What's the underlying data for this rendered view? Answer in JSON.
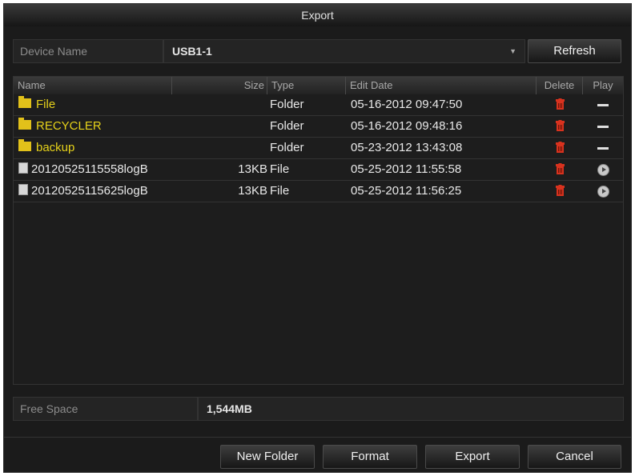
{
  "window": {
    "title": "Export"
  },
  "device": {
    "label": "Device Name",
    "value": "USB1-1",
    "refresh_label": "Refresh"
  },
  "table": {
    "columns": {
      "name": "Name",
      "size": "Size",
      "type": "Type",
      "edit_date": "Edit Date",
      "delete": "Delete",
      "play": "Play"
    },
    "rows": [
      {
        "name": "File",
        "size": "",
        "type": "Folder",
        "edit_date": "05-16-2012 09:47:50",
        "kind": "folder",
        "play": "none"
      },
      {
        "name": "RECYCLER",
        "size": "",
        "type": "Folder",
        "edit_date": "05-16-2012 09:48:16",
        "kind": "folder",
        "play": "none"
      },
      {
        "name": "backup",
        "size": "",
        "type": "Folder",
        "edit_date": "05-23-2012 13:43:08",
        "kind": "folder",
        "play": "none"
      },
      {
        "name": "20120525115558logB",
        "size": "13KB",
        "type": "File",
        "edit_date": "05-25-2012 11:55:58",
        "kind": "file",
        "play": "play-icon"
      },
      {
        "name": "20120525115625logB",
        "size": "13KB",
        "type": "File",
        "edit_date": "05-25-2012 11:56:25",
        "kind": "file",
        "play": "play-icon"
      }
    ]
  },
  "free_space": {
    "label": "Free Space",
    "value": "1,544MB"
  },
  "buttons": {
    "new_folder": "New Folder",
    "format": "Format",
    "export": "Export",
    "cancel": "Cancel"
  },
  "colors": {
    "folder_text": "#e6d21a",
    "delete_icon": "#d8321e",
    "background": "#1b1b1b"
  }
}
